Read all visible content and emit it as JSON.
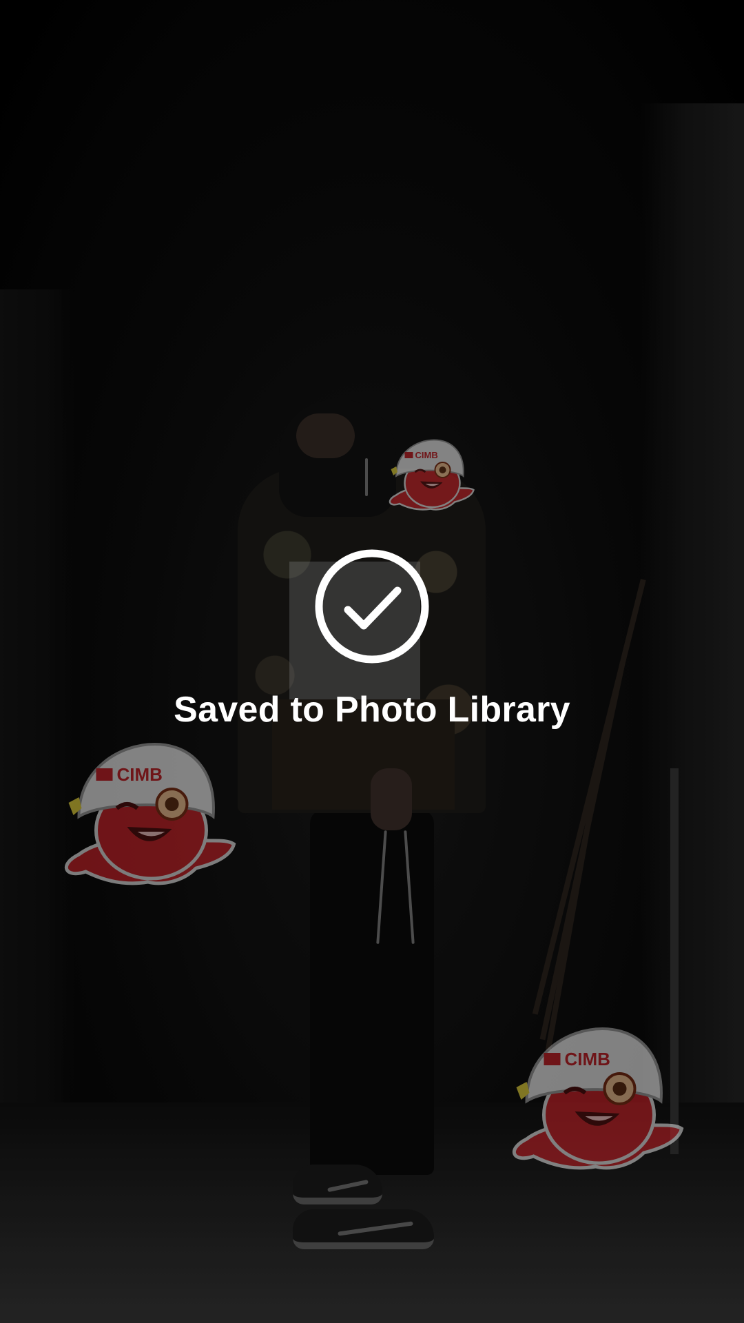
{
  "hud": {
    "message": "Saved to Photo Library",
    "icon": "checkmark-circle-icon",
    "color": "#ffffff"
  },
  "stickers": {
    "character": "octopus-mascot",
    "cap_text": "CIMB",
    "body_color": "#c42026",
    "cap_color": "#e6e6e6"
  }
}
